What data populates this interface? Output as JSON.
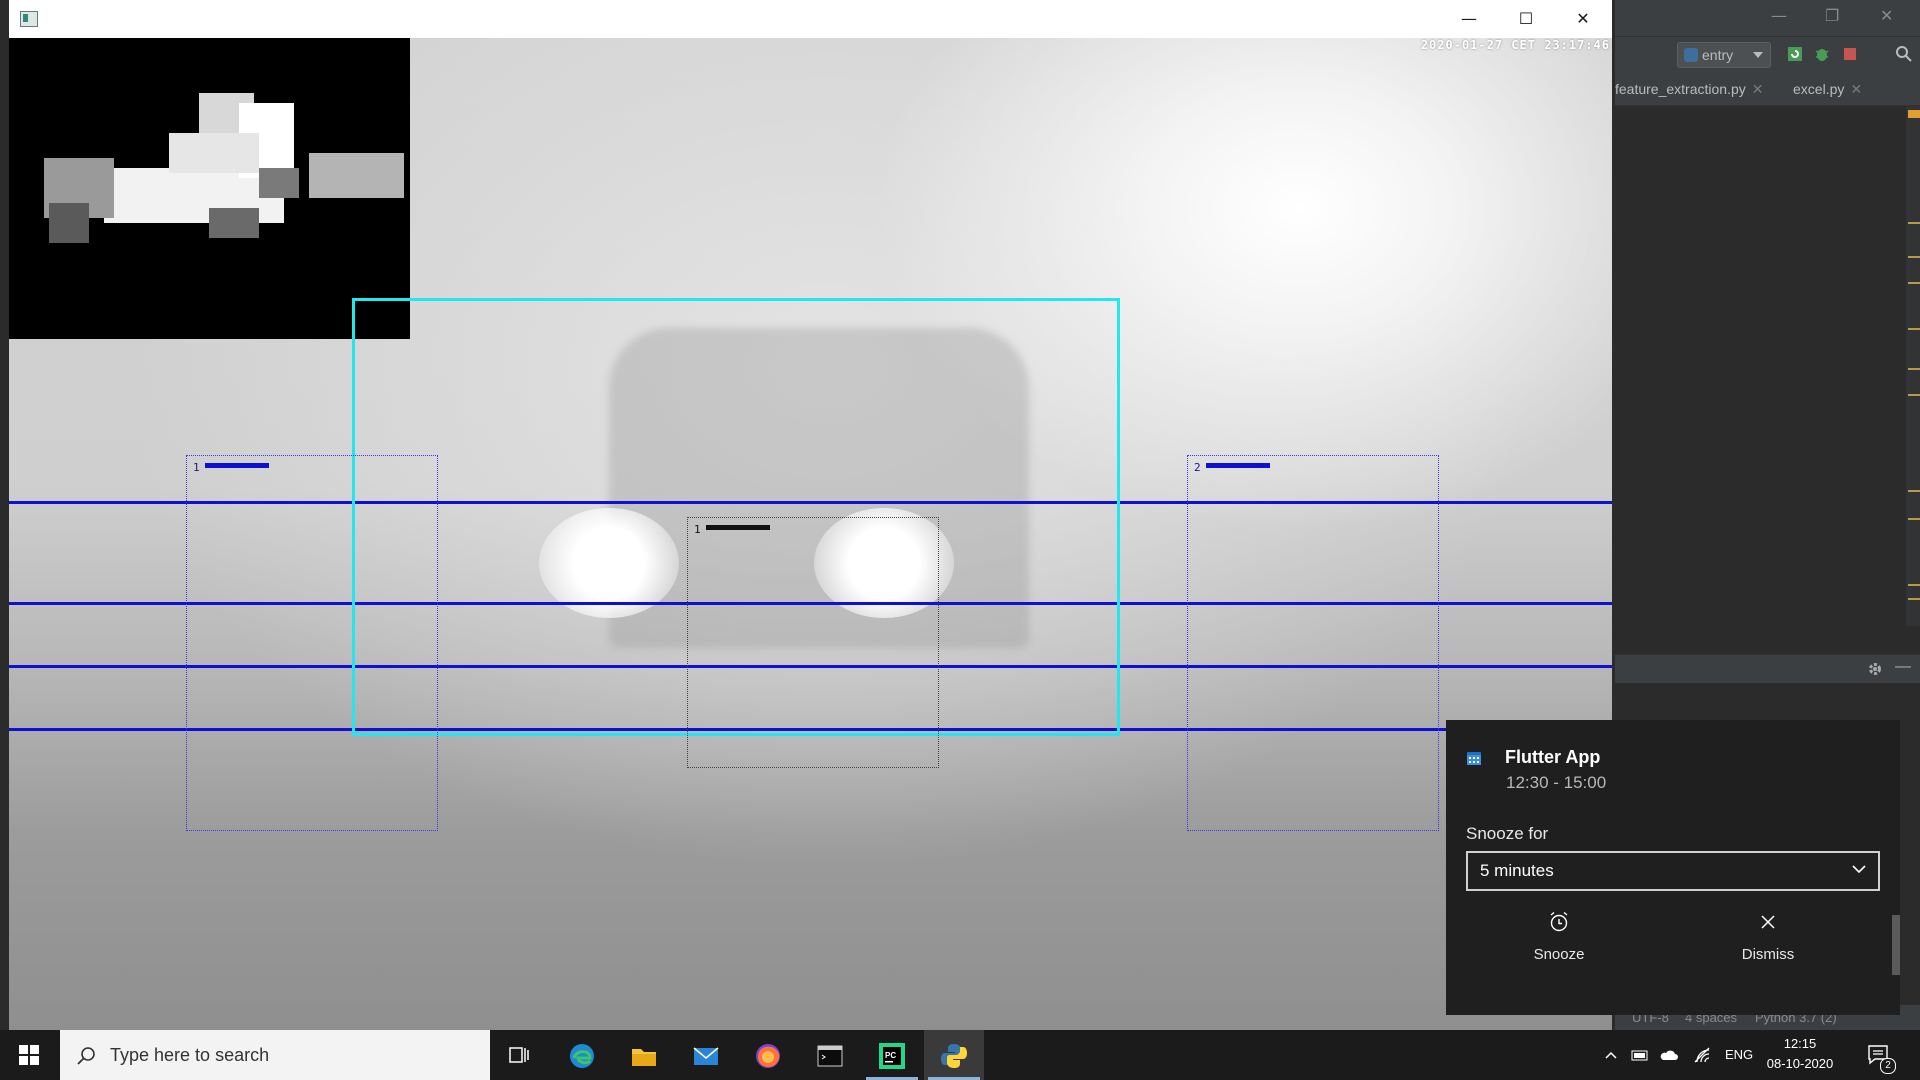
{
  "ide": {
    "run_config": "entry",
    "tabs": [
      {
        "label": "feature_extraction.py"
      },
      {
        "label": "excel.py"
      }
    ],
    "status": {
      "encoding": "UTF-8",
      "indent": "4 spaces",
      "interpreter": "Python 3.7 (2)"
    }
  },
  "viewer": {
    "timestamp": "2020-01-27 CET 23:17:46",
    "window_controls": {
      "minimize": "—",
      "maximize": "☐",
      "close": "✕"
    },
    "rois": [
      {
        "label": "1"
      },
      {
        "label": "1"
      },
      {
        "label": "2"
      }
    ]
  },
  "notification": {
    "title": "Flutter App",
    "time_range": "12:30 - 15:00",
    "snooze_label": "Snooze for",
    "snooze_value": "5 minutes",
    "snooze_button": "Snooze",
    "dismiss_button": "Dismiss"
  },
  "taskbar": {
    "search_placeholder": "Type here to search",
    "apps": [
      "task-view",
      "edge",
      "file-explorer",
      "mail",
      "firefox",
      "terminal",
      "pycharm",
      "python"
    ],
    "language": "ENG",
    "time": "12:15",
    "date": "08-10-2020",
    "notification_count": "2"
  },
  "colors": {
    "cyan_box": "#22e6f0",
    "lane_lines": "#1010d0",
    "toast_bg": "#1f1f1f",
    "taskbar_bg": "#1b1b1b"
  }
}
